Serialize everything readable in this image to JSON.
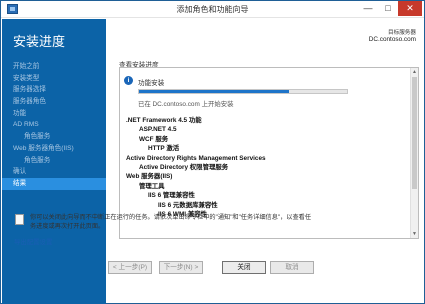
{
  "window": {
    "title": "添加角色和功能向导"
  },
  "controls": {
    "minimize": "—",
    "maximize": "□",
    "close": "✕"
  },
  "sidebar": {
    "heading": "安装进度",
    "items": [
      {
        "label": "开始之前"
      },
      {
        "label": "安装类型"
      },
      {
        "label": "服务器选择"
      },
      {
        "label": "服务器角色"
      },
      {
        "label": "功能"
      },
      {
        "label": "AD RMS"
      },
      {
        "label": "角色服务"
      },
      {
        "label": "Web 服务器角色(IIS)"
      },
      {
        "label": "角色服务"
      },
      {
        "label": "确认"
      },
      {
        "label": "结果"
      }
    ]
  },
  "header": {
    "server_label": "目标服务器",
    "server_name": "DC.contoso.com"
  },
  "main": {
    "section_label": "查看安装进度",
    "status": "功能安装",
    "progress": 0.72,
    "install_target": "已在 DC.contoso.com 上开始安装",
    "features": [
      ".NET Framework 4.5 功能",
      "ASP.NET 4.5",
      "WCF 服务",
      "HTTP 激活",
      "Active Directory Rights Management Services",
      "Active Directory 权限管理服务",
      "Web 服务器(IIS)",
      "管理工具",
      "IIS 6 管理兼容性",
      "IIS 6 元数据库兼容性",
      "IIS 6 WMI 兼容性"
    ],
    "note": "你可以关闭此向导而不中断正在运行的任务。请依次单击命令栏中的\"通知\"和\"任务详细信息\"，以查看任务进度或再次打开此页面。",
    "export_link": "导出配置设置"
  },
  "buttons": {
    "prev": "< 上一步(P)",
    "next": "下一步(N) >",
    "close": "关闭",
    "cancel": "取消"
  },
  "colors": {
    "sidebar_bg": "#0c63a7",
    "active_item": "#2a8fe0",
    "progress": "#1e74c9",
    "link": "#1a5eb4"
  }
}
